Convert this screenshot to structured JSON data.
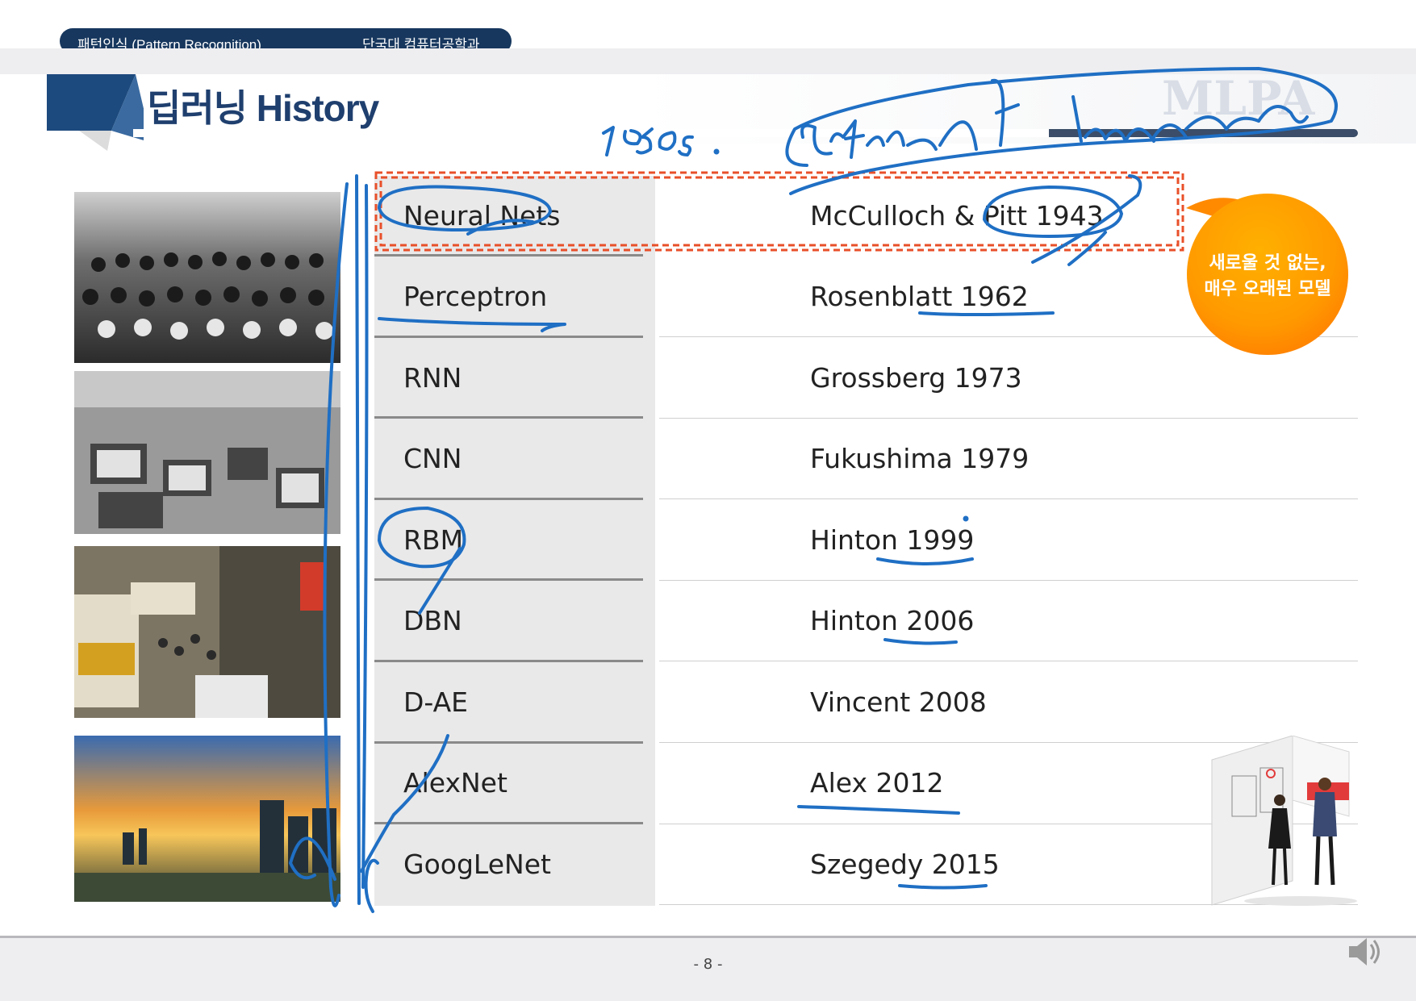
{
  "header": {
    "course": "패턴인식 (Pattern Recognition)",
    "department": "단국대 컴퓨터공학과"
  },
  "title": "딥러닝 History",
  "table": {
    "rows": [
      {
        "name": "Neural Nets",
        "author": "McCulloch & Pitt 1943"
      },
      {
        "name": "Perceptron",
        "author": "Rosenblatt 1962"
      },
      {
        "name": "RNN",
        "author": "Grossberg 1973"
      },
      {
        "name": "CNN",
        "author": "Fukushima 1979"
      },
      {
        "name": "RBM",
        "author": "Hinton 1999"
      },
      {
        "name": "DBN",
        "author": "Hinton 2006"
      },
      {
        "name": "D-AE",
        "author": "Vincent 2008"
      },
      {
        "name": "AlexNet",
        "author": "Alex 2012"
      },
      {
        "name": "GoogLeNet",
        "author": "Szegedy 2015"
      }
    ]
  },
  "callout": {
    "line1": "새로울 것 없는,",
    "line2": "매우 오래된 모델"
  },
  "footer": {
    "page": "- 8 -"
  },
  "colors": {
    "navy": "#17375e",
    "title": "#1f3f6e",
    "orange": "#ff9a00",
    "ink": "#1f6fc4",
    "highlight_box": "#e8502a"
  }
}
